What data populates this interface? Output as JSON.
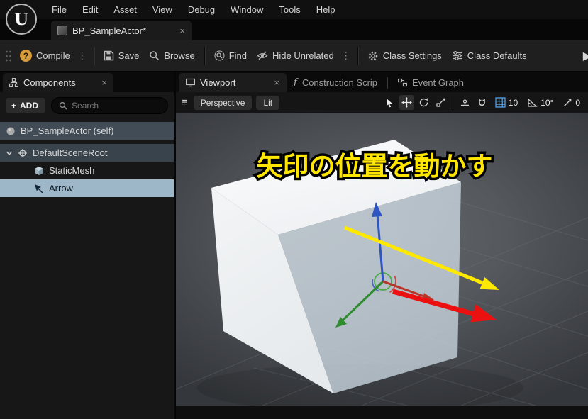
{
  "icons": {
    "overflow": "⋮",
    "close": "×",
    "hamburger": "≡",
    "play": "▶",
    "plus": "+",
    "script": "ƒ"
  },
  "window": {
    "logo_letter": "U",
    "menu_items": [
      "File",
      "Edit",
      "Asset",
      "View",
      "Debug",
      "Window",
      "Tools",
      "Help"
    ]
  },
  "asset_tab": {
    "label": "BP_SampleActor*"
  },
  "toolbar": {
    "compile_label": "Compile",
    "save_label": "Save",
    "browse_label": "Browse",
    "find_label": "Find",
    "hide_unrelated_label": "Hide Unrelated",
    "class_settings_label": "Class Settings",
    "class_defaults_label": "Class Defaults"
  },
  "components_panel": {
    "tab_label": "Components",
    "add_button_label": "ADD",
    "search_placeholder": "Search",
    "tree": [
      {
        "label": "BP_SampleActor (self)"
      },
      {
        "label": "DefaultSceneRoot"
      },
      {
        "label": "StaticMesh"
      },
      {
        "label": "Arrow"
      }
    ]
  },
  "viewport_panel": {
    "tabs": [
      {
        "label": "Viewport"
      },
      {
        "label": "Construction Scrip"
      },
      {
        "label": "Event Graph"
      }
    ],
    "camera_mode": "Perspective",
    "view_mode": "Lit",
    "grid_snap_value": "10",
    "rotation_snap_value": "10°",
    "camera_speed_value": "0",
    "annotation": "矢印の位置を動かす"
  }
}
